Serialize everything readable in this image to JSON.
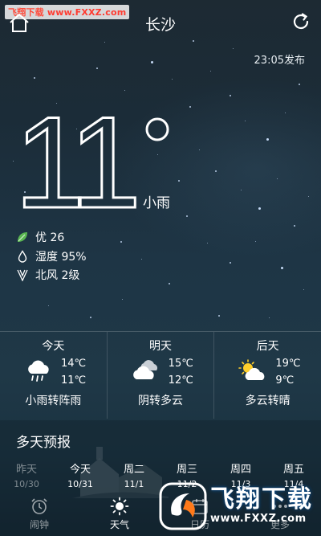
{
  "watermark": {
    "site_cn": "飞翔下载",
    "site_url": "www.FXXZ.com",
    "logo_text": "飞翔下载",
    "logo_url": "www.FXXZ.com"
  },
  "header": {
    "city": "长沙",
    "home_icon": "home-icon",
    "refresh_icon": "refresh-icon"
  },
  "publish_time": "23:05发布",
  "current": {
    "temperature": "11",
    "degree_symbol": "°",
    "condition": "小雨"
  },
  "details": {
    "aqi": {
      "icon": "leaf-icon",
      "text": "优 26",
      "color": "#5ab552"
    },
    "humidity": {
      "icon": "water-drop-icon",
      "text": "湿度 95%"
    },
    "wind": {
      "icon": "wind-icon",
      "text": "北风 2级"
    }
  },
  "forecast": [
    {
      "day": "今天",
      "high": "14℃",
      "low": "11℃",
      "desc": "小雨转阵雨",
      "icon": "rain-cloud-icon"
    },
    {
      "day": "明天",
      "high": "15℃",
      "low": "12℃",
      "desc": "阴转多云",
      "icon": "overcast-cloud-icon"
    },
    {
      "day": "后天",
      "high": "19℃",
      "low": "9℃",
      "desc": "多云转晴",
      "icon": "partly-cloudy-icon"
    }
  ],
  "multi_day": {
    "title": "多天预报",
    "days": [
      {
        "name": "昨天",
        "date": "10/30"
      },
      {
        "name": "今天",
        "date": "10/31"
      },
      {
        "name": "周二",
        "date": "11/1"
      },
      {
        "name": "周三",
        "date": "11/2"
      },
      {
        "name": "周四",
        "date": "11/3"
      },
      {
        "name": "周五",
        "date": "11/4"
      }
    ]
  },
  "tabs": [
    {
      "label": "闹钟",
      "icon": "alarm-clock-icon"
    },
    {
      "label": "天气",
      "icon": "sun-icon"
    },
    {
      "label": "日历",
      "icon": "calendar-icon"
    },
    {
      "label": "更多",
      "icon": "more-icon"
    }
  ]
}
